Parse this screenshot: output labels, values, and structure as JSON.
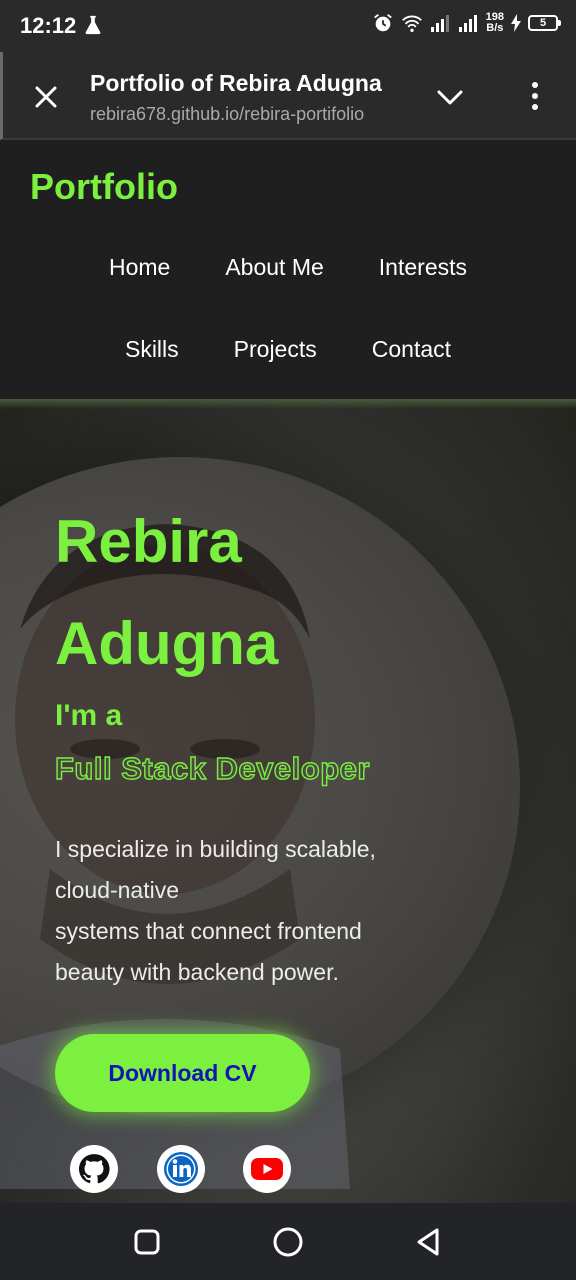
{
  "status_bar": {
    "time": "12:12",
    "speed_value": "198",
    "speed_unit": "B/s",
    "battery": "5",
    "icons": [
      "flask-icon",
      "alarm-icon",
      "wifi-icon",
      "signal-icon",
      "signal-icon",
      "charging-icon",
      "battery-icon"
    ]
  },
  "tab": {
    "title": "Portfolio of Rebira Adugna",
    "url": "rebira678.github.io/rebira-portifolio",
    "icons": [
      "close-icon",
      "chevron-down-icon",
      "more-vert-icon"
    ]
  },
  "site_nav": {
    "logo": "Portfolio",
    "row1": [
      "Home",
      "About Me",
      "Interests"
    ],
    "row2": [
      "Skills",
      "Projects",
      "Contact"
    ]
  },
  "hero": {
    "name_line1": "Rebira",
    "name_line2": "Adugna",
    "intro": "I'm a",
    "role": "Full Stack Developer",
    "desc_lines": [
      "I specialize in building scalable,",
      "cloud-native",
      "systems that connect frontend",
      "beauty with backend power."
    ],
    "cv_button": "Download CV",
    "socials": [
      "github-icon",
      "linkedin-icon",
      "youtube-icon"
    ]
  },
  "android_nav": [
    "recents-icon",
    "home-icon",
    "back-icon"
  ],
  "colors": {
    "accent": "#7cf03e",
    "button_text": "#1414b4",
    "background": "#1f1f1f"
  }
}
